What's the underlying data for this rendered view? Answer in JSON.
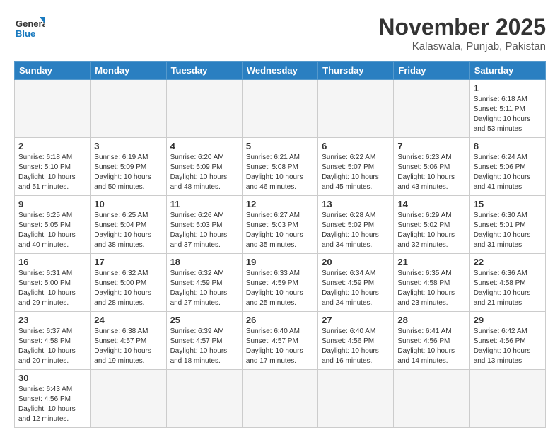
{
  "logo": {
    "text_general": "General",
    "text_blue": "Blue"
  },
  "title": "November 2025",
  "subtitle": "Kalaswala, Punjab, Pakistan",
  "weekdays": [
    "Sunday",
    "Monday",
    "Tuesday",
    "Wednesday",
    "Thursday",
    "Friday",
    "Saturday"
  ],
  "days": {
    "1": {
      "sunrise": "6:18 AM",
      "sunset": "5:11 PM",
      "daylight": "10 hours and 53 minutes."
    },
    "2": {
      "sunrise": "6:18 AM",
      "sunset": "5:10 PM",
      "daylight": "10 hours and 51 minutes."
    },
    "3": {
      "sunrise": "6:19 AM",
      "sunset": "5:09 PM",
      "daylight": "10 hours and 50 minutes."
    },
    "4": {
      "sunrise": "6:20 AM",
      "sunset": "5:09 PM",
      "daylight": "10 hours and 48 minutes."
    },
    "5": {
      "sunrise": "6:21 AM",
      "sunset": "5:08 PM",
      "daylight": "10 hours and 46 minutes."
    },
    "6": {
      "sunrise": "6:22 AM",
      "sunset": "5:07 PM",
      "daylight": "10 hours and 45 minutes."
    },
    "7": {
      "sunrise": "6:23 AM",
      "sunset": "5:06 PM",
      "daylight": "10 hours and 43 minutes."
    },
    "8": {
      "sunrise": "6:24 AM",
      "sunset": "5:06 PM",
      "daylight": "10 hours and 41 minutes."
    },
    "9": {
      "sunrise": "6:25 AM",
      "sunset": "5:05 PM",
      "daylight": "10 hours and 40 minutes."
    },
    "10": {
      "sunrise": "6:25 AM",
      "sunset": "5:04 PM",
      "daylight": "10 hours and 38 minutes."
    },
    "11": {
      "sunrise": "6:26 AM",
      "sunset": "5:03 PM",
      "daylight": "10 hours and 37 minutes."
    },
    "12": {
      "sunrise": "6:27 AM",
      "sunset": "5:03 PM",
      "daylight": "10 hours and 35 minutes."
    },
    "13": {
      "sunrise": "6:28 AM",
      "sunset": "5:02 PM",
      "daylight": "10 hours and 34 minutes."
    },
    "14": {
      "sunrise": "6:29 AM",
      "sunset": "5:02 PM",
      "daylight": "10 hours and 32 minutes."
    },
    "15": {
      "sunrise": "6:30 AM",
      "sunset": "5:01 PM",
      "daylight": "10 hours and 31 minutes."
    },
    "16": {
      "sunrise": "6:31 AM",
      "sunset": "5:00 PM",
      "daylight": "10 hours and 29 minutes."
    },
    "17": {
      "sunrise": "6:32 AM",
      "sunset": "5:00 PM",
      "daylight": "10 hours and 28 minutes."
    },
    "18": {
      "sunrise": "6:32 AM",
      "sunset": "4:59 PM",
      "daylight": "10 hours and 27 minutes."
    },
    "19": {
      "sunrise": "6:33 AM",
      "sunset": "4:59 PM",
      "daylight": "10 hours and 25 minutes."
    },
    "20": {
      "sunrise": "6:34 AM",
      "sunset": "4:59 PM",
      "daylight": "10 hours and 24 minutes."
    },
    "21": {
      "sunrise": "6:35 AM",
      "sunset": "4:58 PM",
      "daylight": "10 hours and 23 minutes."
    },
    "22": {
      "sunrise": "6:36 AM",
      "sunset": "4:58 PM",
      "daylight": "10 hours and 21 minutes."
    },
    "23": {
      "sunrise": "6:37 AM",
      "sunset": "4:58 PM",
      "daylight": "10 hours and 20 minutes."
    },
    "24": {
      "sunrise": "6:38 AM",
      "sunset": "4:57 PM",
      "daylight": "10 hours and 19 minutes."
    },
    "25": {
      "sunrise": "6:39 AM",
      "sunset": "4:57 PM",
      "daylight": "10 hours and 18 minutes."
    },
    "26": {
      "sunrise": "6:40 AM",
      "sunset": "4:57 PM",
      "daylight": "10 hours and 17 minutes."
    },
    "27": {
      "sunrise": "6:40 AM",
      "sunset": "4:56 PM",
      "daylight": "10 hours and 16 minutes."
    },
    "28": {
      "sunrise": "6:41 AM",
      "sunset": "4:56 PM",
      "daylight": "10 hours and 14 minutes."
    },
    "29": {
      "sunrise": "6:42 AM",
      "sunset": "4:56 PM",
      "daylight": "10 hours and 13 minutes."
    },
    "30": {
      "sunrise": "6:43 AM",
      "sunset": "4:56 PM",
      "daylight": "10 hours and 12 minutes."
    }
  }
}
